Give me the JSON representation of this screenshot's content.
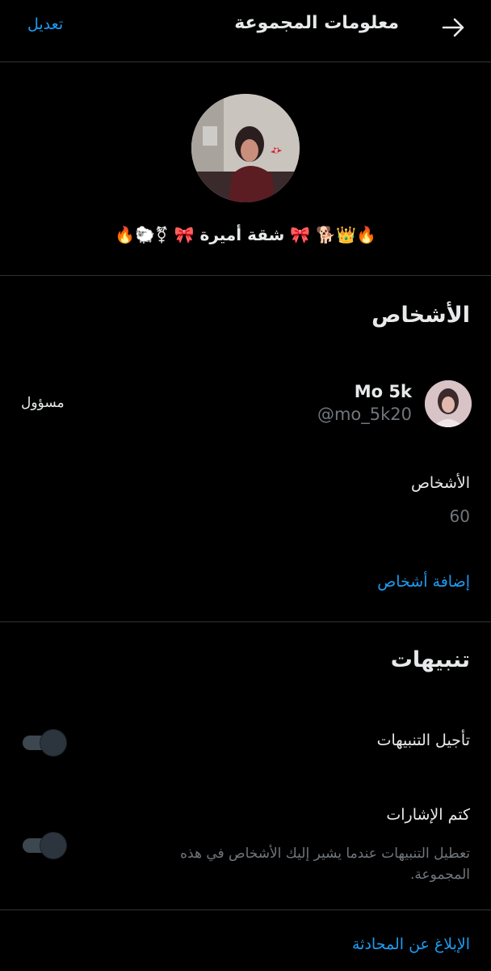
{
  "header": {
    "title": "معلومات المجموعة",
    "edit_label": "تعديل",
    "back_icon": "arrow-right-icon"
  },
  "group": {
    "name": "🔥🐑⚧ 🎀 شقة أميرة 🎀 🐕👑🔥",
    "avatar_icon": "group-avatar-photo"
  },
  "people_section": {
    "title": "الأشخاص",
    "member": {
      "name": "Mo 5k",
      "handle": "@mo_5k20",
      "role": "مسؤول"
    },
    "count_label": "الأشخاص",
    "count_value": "60",
    "add_people_label": "إضافة أشخاص"
  },
  "notifications_section": {
    "title": "تنبيهات",
    "snooze_label": "تأجيل التنبيهات",
    "snooze_on": false,
    "mute_mentions_label": "كتم الإشارات",
    "mute_mentions_desc": "تعطيل التنبيهات عندما يشير إليك الأشخاص في هذه المجموعة.",
    "mute_mentions_on": false
  },
  "report": {
    "label": "الإبلاغ عن المحادثة"
  },
  "colors": {
    "background": "#000000",
    "accent": "#1d9bf0",
    "text": "#e7e9ea",
    "secondary_text": "#71767b",
    "divider": "#2f3336"
  }
}
